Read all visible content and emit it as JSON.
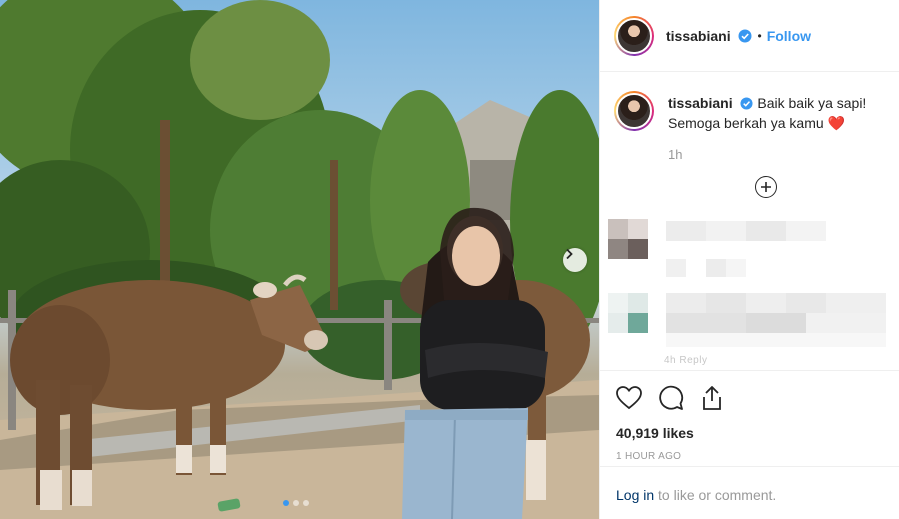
{
  "post": {
    "username": "tissabiani",
    "separator": "•",
    "follow_label": "Follow",
    "caption_line1": "Baik baik ya sapi!",
    "caption_line2": "Semoga berkah ya kamu ❤️",
    "caption_age": "1h",
    "likes": "40,919 likes",
    "posted_ago": "1 HOUR AGO",
    "login_link": "Log in",
    "login_rest": " to like or comment.",
    "comment_meta_partial": "4h    Reply"
  },
  "icons": {
    "verified": "verified-badge-icon",
    "load_more": "plus-circle-icon",
    "next": "chevron-right-icon",
    "like": "heart-icon",
    "comment": "speech-bubble-icon",
    "share": "share-icon"
  },
  "carousel": {
    "count": 3,
    "active_index": 0
  },
  "colors": {
    "accent": "#3897f0",
    "text": "#262626",
    "muted": "#999999",
    "link": "#003569"
  }
}
